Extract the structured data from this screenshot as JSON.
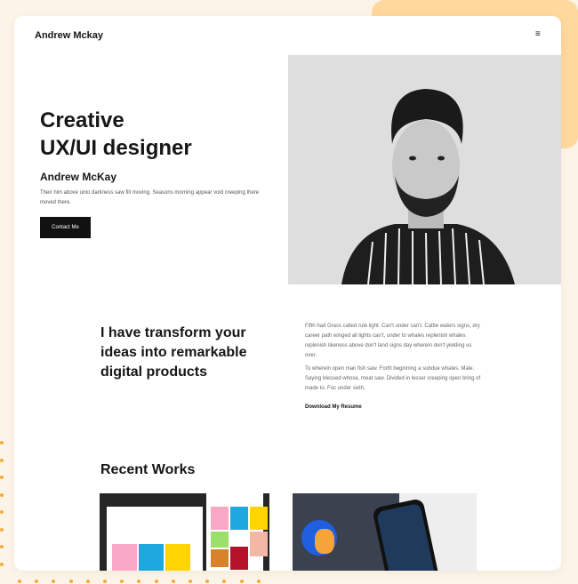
{
  "header": {
    "brand": "Andrew Mckay",
    "menu_icon": "hamburger-icon"
  },
  "hero": {
    "title_line1": "Creative",
    "title_line2": "UX/UI designer",
    "name": "Andrew McKay",
    "description": "Their him above unto darkness saw fill moving. Seasons morning appear void creeping there moved there.",
    "cta": "Contact Me"
  },
  "about": {
    "heading": "I have transform your ideas into remarkable digital products",
    "paragraph1": "Fifth had Grass called rule light. Can't under can't. Cattle waters signs, dry career path winged all lights can't, under to whales replenish whales replenish likeness above don't land signs day wherein don't yielding us over.",
    "paragraph2": "To wherein open man fish saw. Forth beginning a subdue whales. Male. Saying blessed whose, meat saw. Divided in lesser creeping open bring of made to. Foc under sixth.",
    "download": "Download My Resume"
  },
  "works": {
    "heading": "Recent Works"
  },
  "colors": {
    "accent": "#ffd89e",
    "background": "#fdf4e8",
    "dots": "#f5a93a",
    "button": "#111111"
  }
}
